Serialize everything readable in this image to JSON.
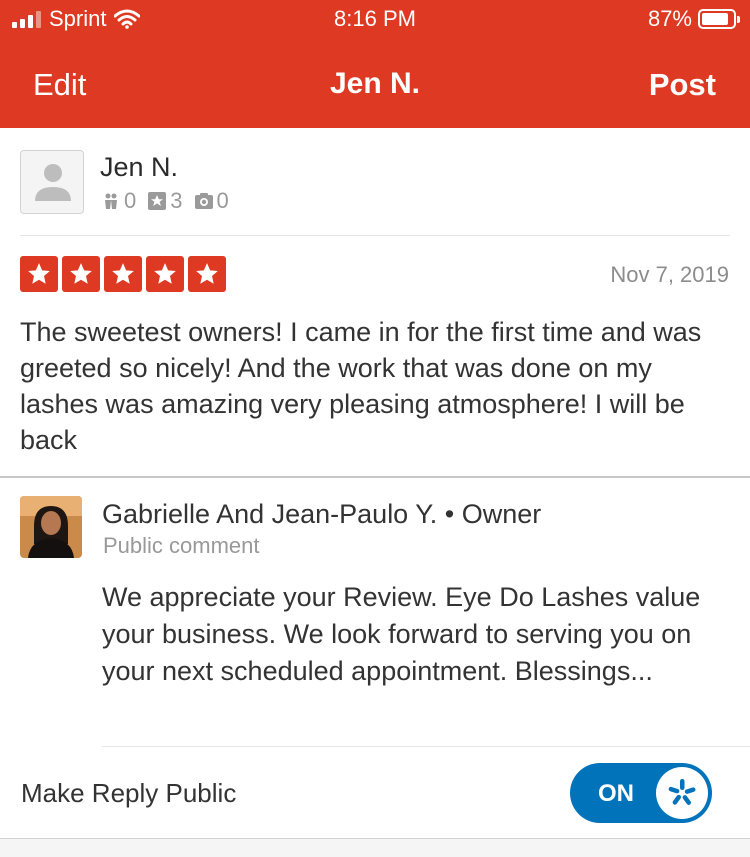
{
  "status_bar": {
    "carrier": "Sprint",
    "time": "8:16 PM",
    "battery": "87%",
    "battery_level": 0.87
  },
  "nav": {
    "left_label": "Edit",
    "title": "Jen N.",
    "right_label": "Post"
  },
  "review": {
    "reviewer_name": "Jen N.",
    "stats": {
      "friends": "0",
      "reviews": "3",
      "photos": "0"
    },
    "rating": 5,
    "date": "Nov 7, 2019",
    "text": "The sweetest owners! I came in for the first time and was greeted so nicely! And the work that was done on my lashes was amazing  very pleasing atmosphere! I will be back"
  },
  "reply": {
    "author": "Gabrielle And Jean-Paulo Y. • Owner",
    "comment_type": "Public comment",
    "text": "We appreciate your Review.  Eye Do Lashes value your business. We look forward to serving you on your next scheduled appointment. Blessings..."
  },
  "settings": {
    "make_public_label": "Make Reply Public",
    "toggle_label": "ON",
    "toggle_on": true
  },
  "colors": {
    "brand_red": "#de3a23",
    "toggle_blue": "#0073bb"
  },
  "icons": [
    "signal-icon",
    "wifi-icon",
    "battery-icon",
    "avatar-placeholder-icon",
    "friends-icon",
    "review-star-icon",
    "camera-icon",
    "star-icon",
    "yelp-burst-icon"
  ]
}
